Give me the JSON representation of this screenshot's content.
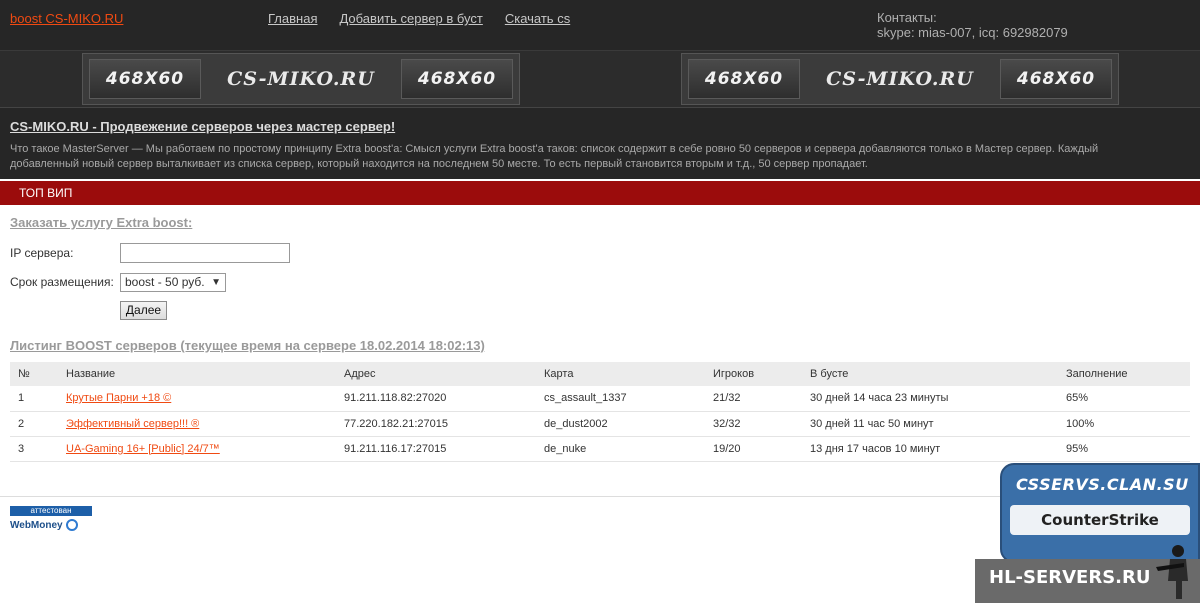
{
  "header": {
    "logo": "boost CS-MIKO.RU",
    "nav": [
      "Главная",
      "Добавить сервер в буст",
      "Скачать cs"
    ],
    "contacts_label": "Контакты:",
    "contacts_value": "skype: mias-007, icq: 692982079"
  },
  "banners": [
    {
      "left_tile": "468X60",
      "center": "CS-MIKO.RU",
      "right_tile": "468X60"
    },
    {
      "left_tile": "468X60",
      "center": "CS-MIKO.RU",
      "right_tile": "468X60"
    }
  ],
  "intro": {
    "title": "CS-MIKO.RU - Продвежение серверов через мастер сервер!",
    "text": "Что такое MasterServer — Мы работаем по простому принципу Extra boost'а: Смысл услуги Extra boost'а таков: список содержит в себе ровно 50 серверов и сервера добавляются только в Мастер сервер. Каждый добавленный новый сервер выталкивает из списка сервер, который находится на последнем 50 месте. То есть первый становится вторым и т.д., 50 сервер пропадает."
  },
  "redbar": {
    "label": "ТОП ВИП"
  },
  "order": {
    "title": "Заказать услугу Extra boost:",
    "ip_label": "IP сервера:",
    "ip_value": "",
    "term_label": "Срок размещения:",
    "term_selected": "boost - 50 руб.",
    "submit": "Далее"
  },
  "listing": {
    "title": "Листинг BOOST серверов (текущее время на сервере 18.02.2014 18:02:13)",
    "columns": [
      "№",
      "Название",
      "Адрес",
      "Карта",
      "Игроков",
      "В бусте",
      "Заполнение"
    ],
    "rows": [
      [
        "1",
        "Крутые Парни +18 ©",
        "91.211.118.82:27020",
        "cs_assault_1337",
        "21/32",
        "30 дней 14 часа 23 минуты",
        "65%"
      ],
      [
        "2",
        "Эффективный сервер!!! ®",
        "77.220.182.21:27015",
        "de_dust2002",
        "32/32",
        "30 дней 11 час 50 минут",
        "100%"
      ],
      [
        "3",
        "UA-Gaming 16+ [Public] 24/7™",
        "91.211.116.17:27015",
        "de_nuke",
        "19/20",
        "13 дня 17 часов 10 минут",
        "95%"
      ]
    ]
  },
  "footer": {
    "wm_top": "аттестован",
    "wm_brand": "WebMoney"
  },
  "watermark": {
    "top": "CSSERVS.CLAN.SU",
    "middle": "CounterStrike",
    "bottom": "HL-SERVERS.RU"
  }
}
